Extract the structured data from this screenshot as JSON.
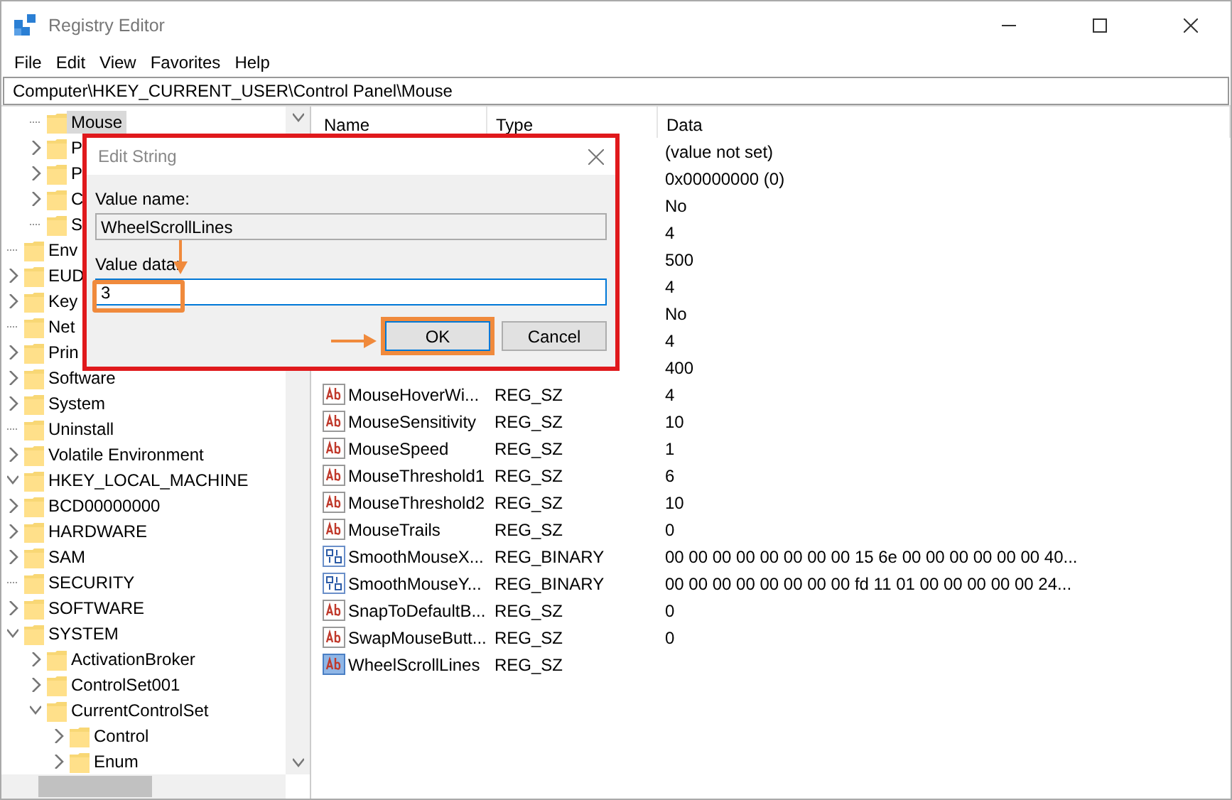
{
  "window": {
    "title": "Registry Editor"
  },
  "menu": [
    "File",
    "Edit",
    "View",
    "Favorites",
    "Help"
  ],
  "address": "Computer\\HKEY_CURRENT_USER\\Control Panel\\Mouse",
  "tree": [
    {
      "children": [
        {
          "children": [
            {
              "label": "Mouse",
              "selected": true
            },
            {
              "label": "P",
              "expanded": false,
              "selected": false
            },
            {
              "label": "P",
              "expanded": false,
              "selected": false
            },
            {
              "label": "C",
              "expanded": false,
              "selected": false
            },
            {
              "label": "S",
              "selected": false
            }
          ]
        },
        {
          "label": "Env",
          "selected": false
        },
        {
          "label": "EUD",
          "expanded": false,
          "selected": false
        },
        {
          "label": "Key",
          "expanded": false,
          "selected": false
        },
        {
          "label": "Net",
          "selected": false
        },
        {
          "label": "Prin",
          "expanded": false,
          "selected": false
        },
        {
          "label": "Software",
          "expanded": false,
          "selected": false
        },
        {
          "label": "System",
          "expanded": false,
          "selected": false
        },
        {
          "label": "Uninstall",
          "selected": false
        },
        {
          "label": "Volatile Environment",
          "expanded": false,
          "selected": false
        }
      ]
    },
    {
      "label": "HKEY_LOCAL_MACHINE",
      "expanded": true,
      "selected": false,
      "children": [
        {
          "label": "BCD00000000",
          "expanded": false,
          "selected": false
        },
        {
          "label": "HARDWARE",
          "expanded": false,
          "selected": false
        },
        {
          "label": "SAM",
          "expanded": false,
          "selected": false
        },
        {
          "label": "SECURITY",
          "selected": false
        },
        {
          "label": "SOFTWARE",
          "expanded": false,
          "selected": false
        },
        {
          "label": "SYSTEM",
          "expanded": true,
          "selected": false,
          "children": [
            {
              "label": "ActivationBroker",
              "expanded": false,
              "selected": false
            },
            {
              "label": "ControlSet001",
              "expanded": false,
              "selected": false
            },
            {
              "label": "CurrentControlSet",
              "expanded": true,
              "selected": false,
              "children": [
                {
                  "label": "Control",
                  "expanded": false,
                  "selected": false
                },
                {
                  "label": "Enum",
                  "expanded": false,
                  "selected": false
                }
              ]
            }
          ]
        }
      ]
    }
  ],
  "list": {
    "columns": [
      "Name",
      "Type",
      "Data"
    ],
    "rows": [
      {
        "data": "(value not set)"
      },
      {
        "data": "0x00000000 (0)"
      },
      {
        "data": "No"
      },
      {
        "data": "4"
      },
      {
        "data": "500"
      },
      {
        "data": "4"
      },
      {
        "data": "No"
      },
      {
        "data": "4"
      },
      {
        "data": "400"
      },
      {
        "kind": "sz",
        "name": "MouseHoverWi...",
        "type": "REG_SZ",
        "data": "4"
      },
      {
        "kind": "sz",
        "name": "MouseSensitivity",
        "type": "REG_SZ",
        "data": "10"
      },
      {
        "kind": "sz",
        "name": "MouseSpeed",
        "type": "REG_SZ",
        "data": "1"
      },
      {
        "kind": "sz",
        "name": "MouseThreshold1",
        "type": "REG_SZ",
        "data": "6"
      },
      {
        "kind": "sz",
        "name": "MouseThreshold2",
        "type": "REG_SZ",
        "data": "10"
      },
      {
        "kind": "sz",
        "name": "MouseTrails",
        "type": "REG_SZ",
        "data": "0"
      },
      {
        "kind": "binary",
        "name": "SmoothMouseX...",
        "type": "REG_BINARY",
        "data": "00 00 00 00 00 00 00 00 15 6e 00 00 00 00 00 00 40..."
      },
      {
        "kind": "binary",
        "name": "SmoothMouseY...",
        "type": "REG_BINARY",
        "data": "00 00 00 00 00 00 00 00 fd 11 01 00 00 00 00 00 24..."
      },
      {
        "kind": "sz",
        "name": "SnapToDefaultB...",
        "type": "REG_SZ",
        "data": "0"
      },
      {
        "kind": "sz",
        "name": "SwapMouseButt...",
        "type": "REG_SZ",
        "data": "0"
      },
      {
        "kind": "sz",
        "name": "WheelScrollLines",
        "type": "REG_SZ",
        "selected": true
      }
    ]
  },
  "dialog": {
    "title": "Edit String",
    "name_label": "Value name:",
    "name_value": "WheelScrollLines",
    "data_label": "Value data:",
    "data_value": "3",
    "buttons": [
      "OK",
      "Cancel"
    ]
  }
}
